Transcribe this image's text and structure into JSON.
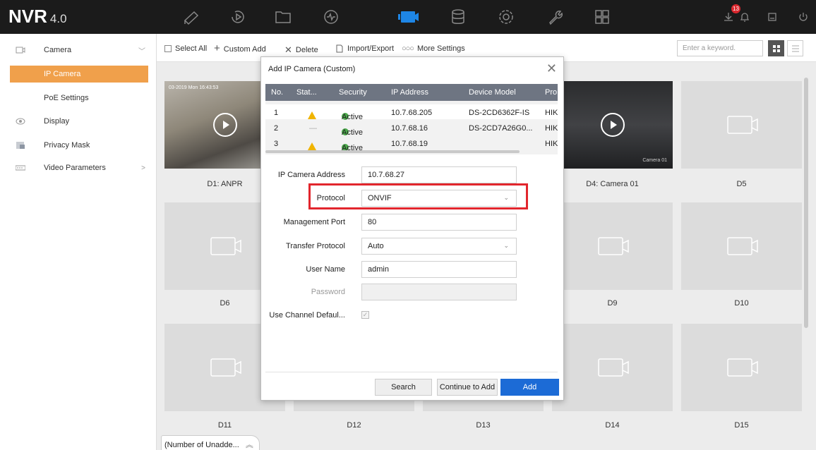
{
  "app": {
    "brand": "NVR",
    "version": "4.0",
    "notification_count": "13"
  },
  "colors": {
    "accent_orange": "#f0a04b",
    "primary_blue": "#1c6bd6",
    "highlight_red": "#e2262d",
    "topbar": "#1b1b1b"
  },
  "nav_icons": [
    "live-view-icon",
    "playback-icon",
    "file-management-icon",
    "smart-analysis-icon",
    "camera-icon",
    "storage-icon",
    "system-settings-icon",
    "maintenance-icon",
    "layout-icon"
  ],
  "sidebar": {
    "camera": "Camera",
    "ip_camera": "IP Camera",
    "poe_settings": "PoE Settings",
    "display": "Display",
    "privacy_mask": "Privacy Mask",
    "video_parameters": "Video Parameters"
  },
  "toolbar": {
    "select_all": "Select All",
    "custom_add": "Custom Add",
    "delete": "Delete",
    "import_export": "Import/Export",
    "more_settings": "More Settings",
    "search_placeholder": "Enter a keyword."
  },
  "tiles": {
    "d1": "D1: ANPR",
    "d4": "D4: Camera 01",
    "d5": "D5",
    "d6": "D6",
    "d9": "D9",
    "d10": "D10",
    "d11": "D11",
    "d12": "D12",
    "d13": "D13",
    "d14": "D14",
    "d15": "D15",
    "d1_timestamp": "03-2019 Mon 16:43:53",
    "d4_overlay": "Camera 01"
  },
  "bottom_tab": "(Number of Unadde...",
  "modal": {
    "title": "Add IP Camera (Custom)",
    "columns": [
      "No.",
      "Stat...",
      "Security",
      "IP Address",
      "Device Model",
      "Pro"
    ],
    "rows": [
      {
        "no": "1",
        "status": "warning",
        "security": "Active",
        "ip": "10.7.68.205",
        "model": "DS-2CD6362F-IS",
        "protocol": "HIK"
      },
      {
        "no": "2",
        "status": "—",
        "security": "Active",
        "ip": "10.7.68.16",
        "model": "DS-2CD7A26G0...",
        "protocol": "HIK"
      },
      {
        "no": "3",
        "status": "warning",
        "security": "Active",
        "ip": "10.7.68.19",
        "model": "",
        "protocol": "HIK"
      }
    ],
    "form": {
      "ip_label": "IP Camera Address",
      "ip_value": "10.7.68.27",
      "protocol_label": "Protocol",
      "protocol_value": "ONVIF",
      "mgmt_port_label": "Management Port",
      "mgmt_port_value": "80",
      "transfer_label": "Transfer Protocol",
      "transfer_value": "Auto",
      "user_label": "User Name",
      "user_value": "admin",
      "password_label": "Password",
      "password_value": "",
      "channel_default_label": "Use Channel Defaul..."
    },
    "buttons": {
      "search": "Search",
      "continue": "Continue to Add",
      "add": "Add"
    }
  }
}
